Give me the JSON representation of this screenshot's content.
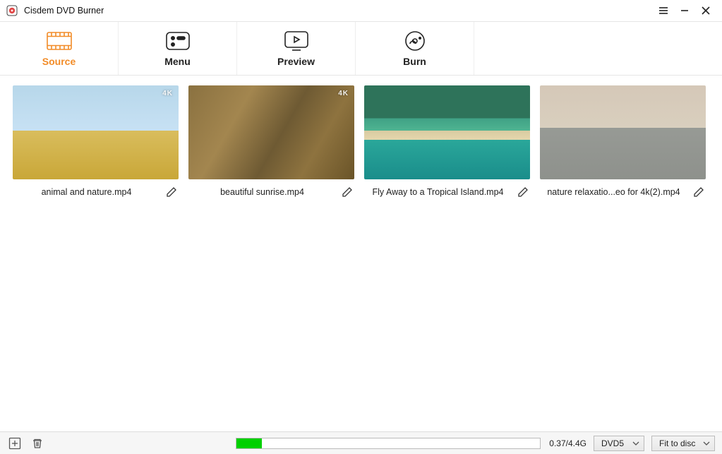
{
  "window": {
    "title": "Cisdem DVD Burner"
  },
  "tabs": [
    {
      "id": "source",
      "label": "Source",
      "active": true
    },
    {
      "id": "menu",
      "label": "Menu",
      "active": false
    },
    {
      "id": "preview",
      "label": "Preview",
      "active": false
    },
    {
      "id": "burn",
      "label": "Burn",
      "active": false
    }
  ],
  "videos": [
    {
      "filename": "animal and nature.mp4",
      "badge": "4K",
      "scene": "scene-giraffes"
    },
    {
      "filename": "beautiful sunrise.mp4",
      "badge": "4K",
      "scene": "scene-deer"
    },
    {
      "filename": "Fly Away to a Tropical Island.mp4",
      "badge": "",
      "scene": "scene-island"
    },
    {
      "filename": "nature relaxatio...eo for 4k(2).mp4",
      "badge": "",
      "scene": "scene-flamingos"
    }
  ],
  "footer": {
    "size_text": "0.37/4.4G",
    "disc_type": "DVD5",
    "quality": "Fit to disc",
    "progress_percent": 8.4
  },
  "icons": {
    "add": "add-icon",
    "delete": "trash-icon",
    "edit": "pencil-icon",
    "hamburger": "hamburger-icon",
    "minimize": "minimize-icon",
    "close": "close-icon"
  }
}
